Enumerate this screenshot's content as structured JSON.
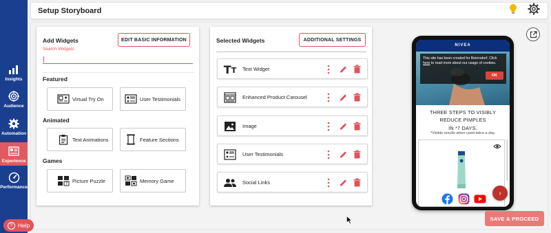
{
  "header": {
    "title": "Setup Storyboard",
    "hint_icon": "lightbulb-icon",
    "settings_icon": "gear-icon"
  },
  "sidenav": {
    "items": [
      {
        "label": "Insights",
        "icon": "bar-chart-icon",
        "active": false
      },
      {
        "label": "Audience",
        "icon": "target-icon",
        "active": false
      },
      {
        "label": "Automation",
        "icon": "gear-icon",
        "active": false
      },
      {
        "label": "Experience",
        "icon": "layout-icon",
        "active": true
      },
      {
        "label": "Performance",
        "icon": "gauge-icon",
        "active": false
      }
    ]
  },
  "add_widgets": {
    "title": "Add Widgets",
    "edit_button": "EDIT BASIC INFORMATION",
    "search_label": "Search Widgets",
    "search_value": "",
    "sections": [
      {
        "label": "Featured",
        "items": [
          {
            "label": "Virtual Try On",
            "icon": "virtual-try-on-icon"
          },
          {
            "label": "User Testimonials",
            "icon": "testimonials-icon"
          }
        ]
      },
      {
        "label": "Animated",
        "items": [
          {
            "label": "Text Animations",
            "icon": "clipboard-icon"
          },
          {
            "label": "Feature Sections",
            "icon": "scroll-icon"
          }
        ]
      },
      {
        "label": "Games",
        "items": [
          {
            "label": "Picture Puzzle",
            "icon": "puzzle-icon"
          },
          {
            "label": "Memory Game",
            "icon": "memory-game-icon"
          }
        ]
      }
    ]
  },
  "selected_widgets": {
    "title": "Selected Widgets",
    "settings_button": "ADDITIONAL SETTINGS",
    "items": [
      {
        "label": "Text Widget",
        "icon": "text-icon"
      },
      {
        "label": "Enhanced Product Carousel",
        "icon": "carousel-icon"
      },
      {
        "label": "Image",
        "icon": "image-icon"
      },
      {
        "label": "User Testimonials",
        "icon": "testimonials-icon"
      },
      {
        "label": "Social Links",
        "icon": "people-icon"
      }
    ]
  },
  "preview": {
    "brand": "NIVEA",
    "cookie_text_1": "This site has been created for Beiersdorf. Click",
    "cookie_link": "here",
    "cookie_text_2": " to read more about our usage of cookies.",
    "cookie_ok": "OK",
    "headline_1": "THREE STEPS TO VISIBLY REDUCE PIMPLES",
    "headline_2": "IN *7 DAYS.",
    "subnote": "*Visible results when used twice a day."
  },
  "actions": {
    "save": "SAVE & PROCEED",
    "help": "Help"
  },
  "colors": {
    "nav": "#1a3f8f",
    "accent": "#e0545c",
    "save": "#ea7a78"
  }
}
